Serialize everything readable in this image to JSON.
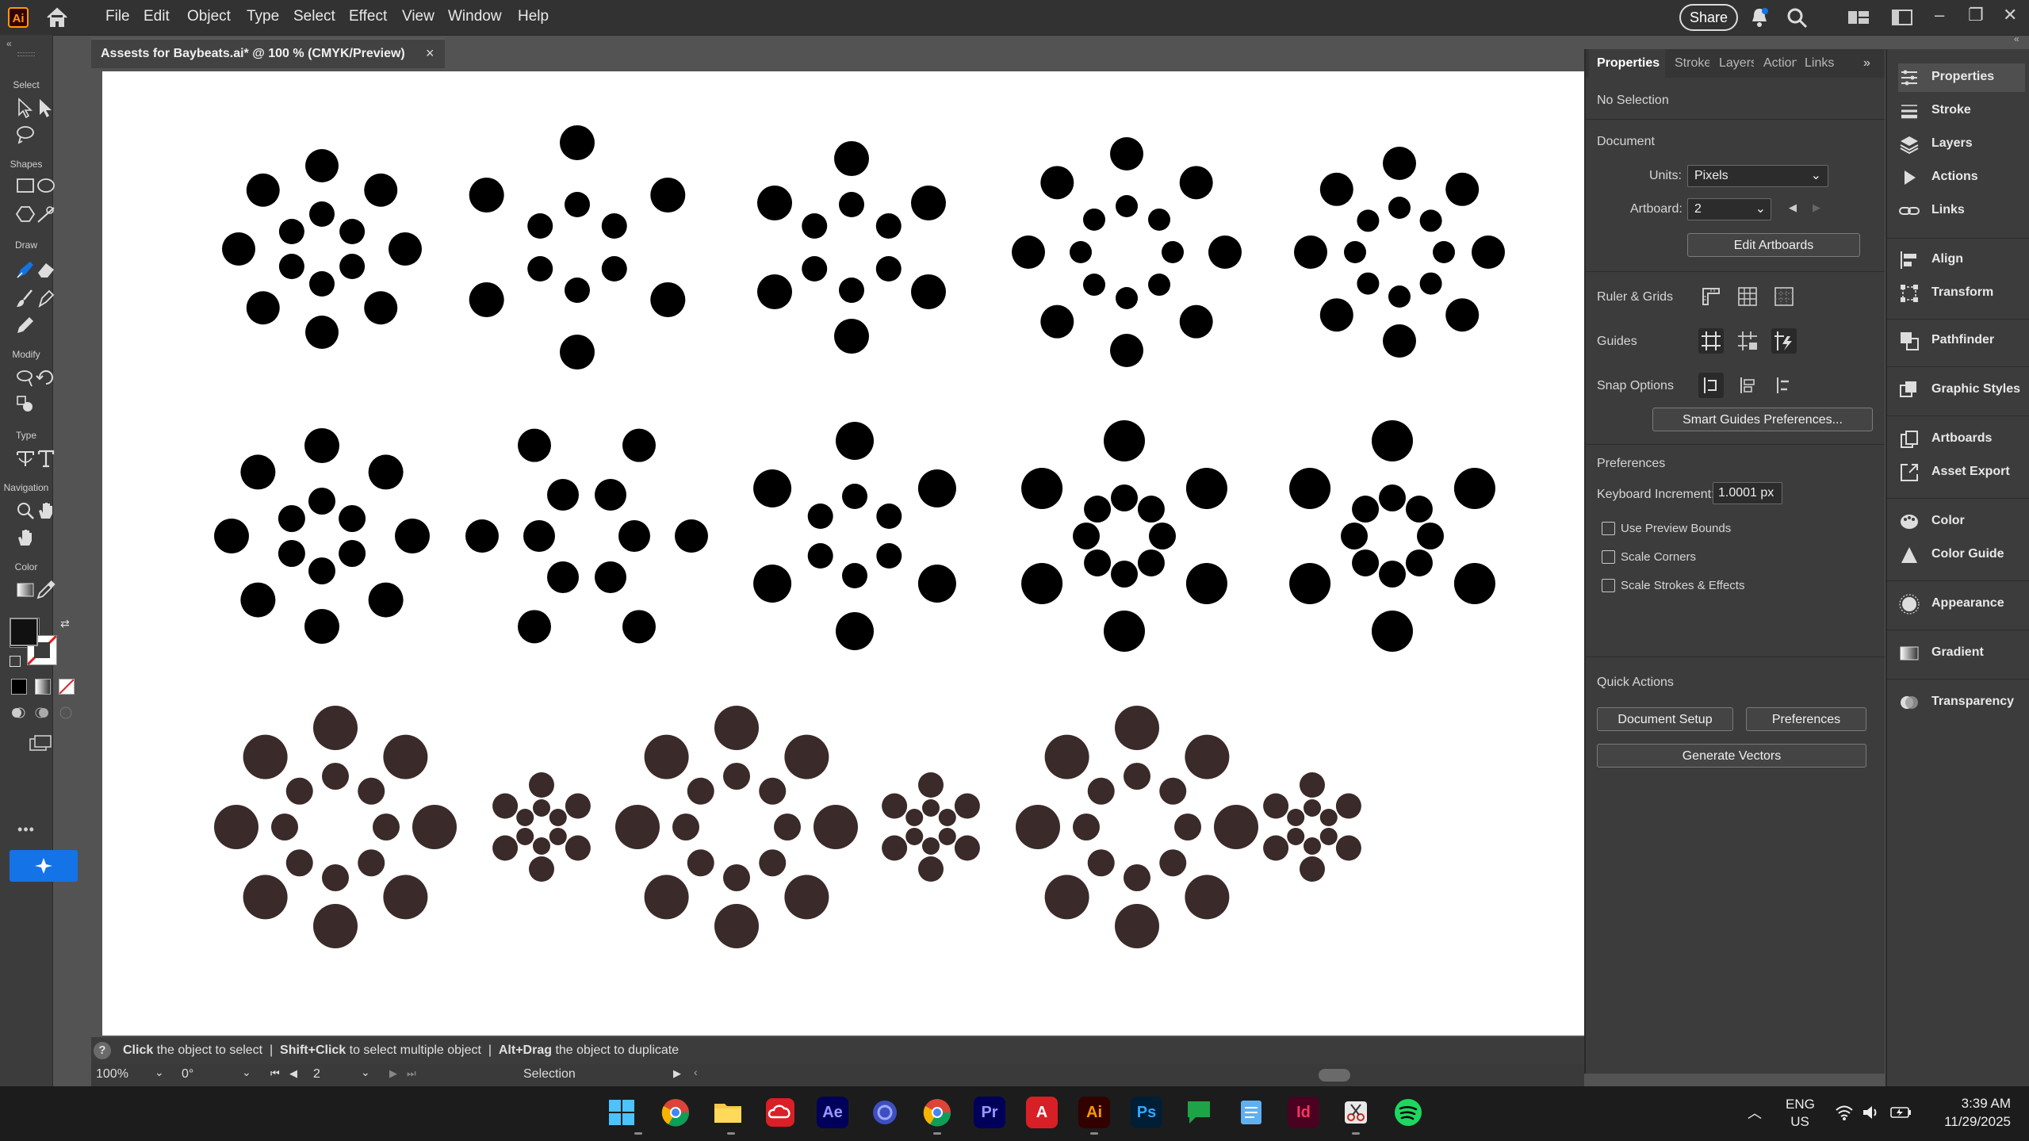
{
  "app": {
    "logo": "Ai",
    "window_controls": [
      "minimize-icon",
      "restore-icon",
      "close-icon"
    ]
  },
  "menubar": {
    "items": [
      "File",
      "Edit",
      "Object",
      "Type",
      "Select",
      "Effect",
      "View",
      "Window",
      "Help"
    ],
    "share_label": "Share"
  },
  "tools": {
    "sections": {
      "select": "Select",
      "shapes": "Shapes",
      "draw": "Draw",
      "modify": "Modify",
      "type": "Type",
      "navigation": "Navigation",
      "color": "Color"
    },
    "more": "•••"
  },
  "document": {
    "tab_title": "Assests for Baybeats.ai* @ 100 % (CMYK/Preview)",
    "close": "×"
  },
  "hint": {
    "part1_bold": "Click",
    "part1": " the object to select",
    "sep": "|",
    "part2_bold": "Shift+Click",
    "part2": " to select multiple object",
    "part3_bold": "Alt+Drag",
    "part3": " the object to duplicate"
  },
  "statusbar": {
    "zoom": "100%",
    "rotation": "0°",
    "artboard": "2",
    "tool": "Selection"
  },
  "properties": {
    "tabs": [
      "Properties",
      "Stroke",
      "Layers",
      "Actions",
      "Links"
    ],
    "no_selection": "No Selection",
    "document_heading": "Document",
    "units_label": "Units:",
    "units_value": "Pixels",
    "artboard_label": "Artboard:",
    "artboard_value": "2",
    "edit_artboards": "Edit Artboards",
    "ruler_grids": "Ruler & Grids",
    "guides": "Guides",
    "snap_options": "Snap Options",
    "smart_guides_btn": "Smart Guides Preferences...",
    "preferences_heading": "Preferences",
    "keyboard_increment_label": "Keyboard Increment:",
    "keyboard_increment_value": "1.0001 px",
    "checkboxes": [
      "Use Preview Bounds",
      "Scale Corners",
      "Scale Strokes & Effects"
    ],
    "quick_actions_heading": "Quick Actions",
    "document_setup_btn": "Document Setup",
    "preferences_btn": "Preferences",
    "generate_vectors_btn": "Generate Vectors"
  },
  "strip": {
    "items": [
      "Properties",
      "Stroke",
      "Layers",
      "Actions",
      "Links",
      "Align",
      "Transform",
      "Pathfinder",
      "Graphic Styles",
      "Artboards",
      "Asset Export",
      "Color",
      "Color Guide",
      "Appearance",
      "Gradient",
      "Transparency"
    ]
  },
  "taskbar": {
    "lang": "ENG",
    "region": "US",
    "time": "3:39 AM",
    "date": "11/29/2025"
  },
  "colors": {
    "black_dots": "#000000",
    "brown_dots": "#3a2a2a",
    "accent": "#1473e6"
  }
}
